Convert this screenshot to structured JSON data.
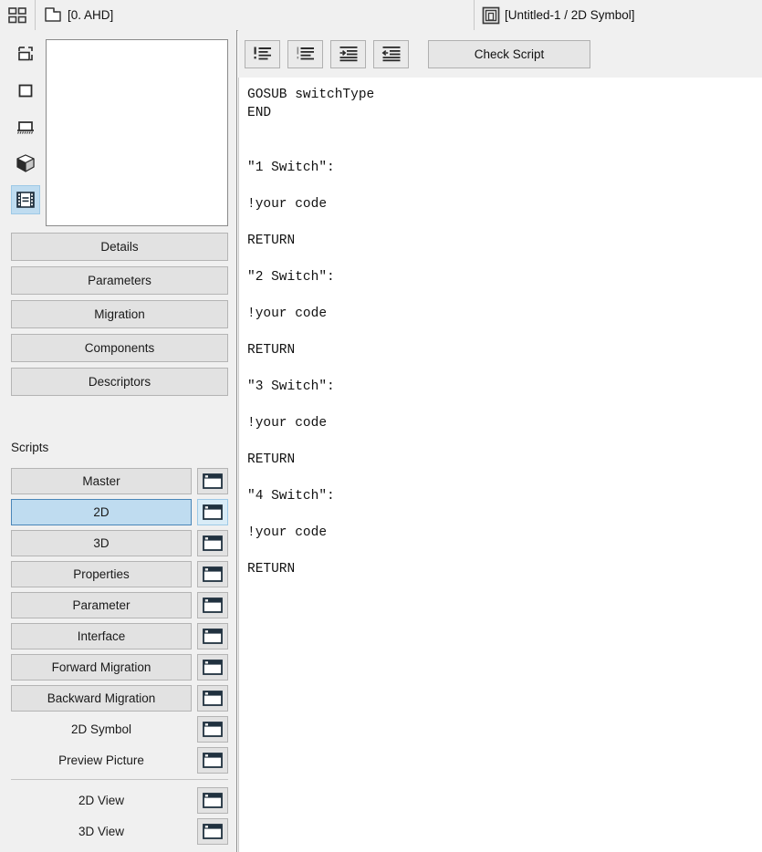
{
  "titlebar": {
    "grid_icon": "grid-icon",
    "project_tab": {
      "icon": "document-corner-icon",
      "label": "[0. AHD]"
    },
    "document_tab": {
      "icon": "nested-square-icon",
      "label": "[Untitled-1 / 2D Symbol]"
    }
  },
  "sidebar": {
    "rail_items": [
      {
        "name": "selection-tool-icon",
        "selected": false
      },
      {
        "name": "rectangle-tool-icon",
        "selected": false
      },
      {
        "name": "elevation-view-icon",
        "selected": false
      },
      {
        "name": "cube-3d-icon",
        "selected": false
      },
      {
        "name": "filmstrip-scripts-icon",
        "selected": true
      }
    ],
    "preview": {
      "name": "symbol-preview",
      "content": ""
    },
    "sections": [
      {
        "label": "Details"
      },
      {
        "label": "Parameters"
      },
      {
        "label": "Migration"
      },
      {
        "label": "Components"
      },
      {
        "label": "Descriptors"
      }
    ],
    "scripts_heading": "Scripts",
    "scripts": [
      {
        "label": "Master",
        "selected": false,
        "plain": false,
        "divider_after": false
      },
      {
        "label": "2D",
        "selected": true,
        "plain": false,
        "divider_after": false
      },
      {
        "label": "3D",
        "selected": false,
        "plain": false,
        "divider_after": false
      },
      {
        "label": "Properties",
        "selected": false,
        "plain": false,
        "divider_after": false
      },
      {
        "label": "Parameter",
        "selected": false,
        "plain": false,
        "divider_after": false
      },
      {
        "label": "Interface",
        "selected": false,
        "plain": false,
        "divider_after": false
      },
      {
        "label": "Forward Migration",
        "selected": false,
        "plain": false,
        "divider_after": false
      },
      {
        "label": "Backward Migration",
        "selected": false,
        "plain": false,
        "divider_after": false
      },
      {
        "label": "2D Symbol",
        "selected": false,
        "plain": true,
        "divider_after": false
      },
      {
        "label": "Preview Picture",
        "selected": false,
        "plain": true,
        "divider_after": true
      },
      {
        "label": "2D View",
        "selected": false,
        "plain": true,
        "divider_after": false
      },
      {
        "label": "3D View",
        "selected": false,
        "plain": true,
        "divider_after": false
      }
    ],
    "script_window_icon": "open-window-icon"
  },
  "editor": {
    "toolbar": [
      {
        "name": "comment-lines-button",
        "icon": "comment-lines-icon"
      },
      {
        "name": "uncomment-lines-button",
        "icon": "uncomment-lines-icon"
      },
      {
        "name": "indent-right-button",
        "icon": "indent-right-icon"
      },
      {
        "name": "indent-left-button",
        "icon": "indent-left-icon"
      }
    ],
    "check_script_label": "Check Script",
    "code": "GOSUB switchType\nEND\n\n\n\"1 Switch\":\n\n!your code\n\nRETURN\n\n\"2 Switch\":\n\n!your code\n\nRETURN\n\n\"3 Switch\":\n\n!your code\n\nRETURN\n\n\"4 Switch\":\n\n!your code\n\nRETURN"
  },
  "colors": {
    "panel_bg": "#f0f0f0",
    "button_bg": "#e2e2e2",
    "button_border": "#b4b4b4",
    "selection_bg": "#bfdcf0",
    "selection_border": "#4a86b8",
    "editor_bg": "#ffffff",
    "text": "#1a1a1a"
  }
}
